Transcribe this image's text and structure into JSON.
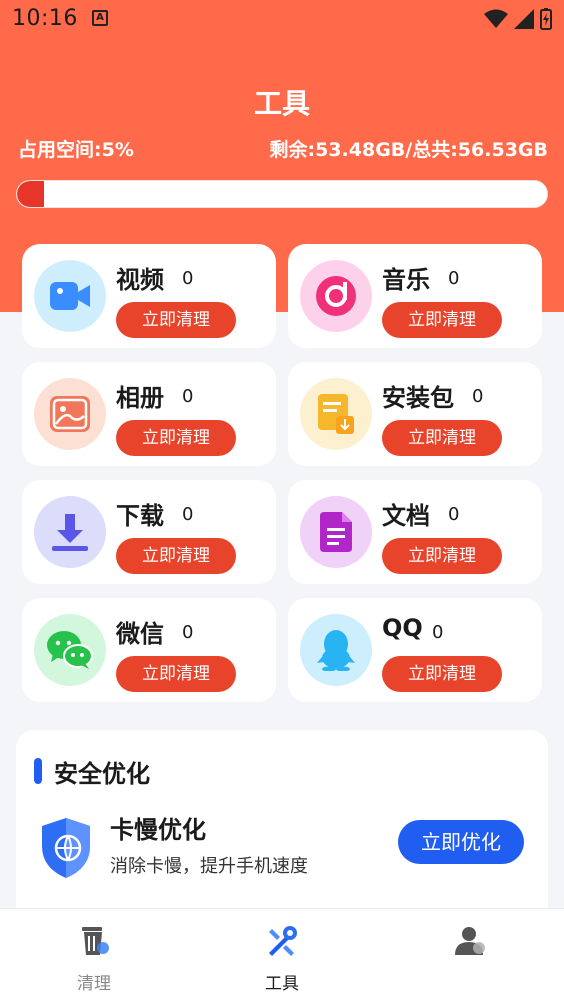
{
  "status_bar": {
    "time": "10:16",
    "notification_letter": "A"
  },
  "header": {
    "title": "工具",
    "space_used_label": "占用空间:5%",
    "space_remaining_label": "剩余:53.48GB/总共:56.53GB",
    "usage_fraction": 0.05,
    "accent_color": "#ff6a4a"
  },
  "categories": [
    {
      "title": "视频",
      "count": "0",
      "button": "立即清理",
      "icon": "video-icon"
    },
    {
      "title": "音乐",
      "count": "0",
      "button": "立即清理",
      "icon": "music-icon"
    },
    {
      "title": "相册",
      "count": "0",
      "button": "立即清理",
      "icon": "photo-album-icon"
    },
    {
      "title": "安装包",
      "count": "0",
      "button": "立即清理",
      "icon": "install-package-icon"
    },
    {
      "title": "下载",
      "count": "0",
      "button": "立即清理",
      "icon": "download-icon"
    },
    {
      "title": "文档",
      "count": "0",
      "button": "立即清理",
      "icon": "document-icon"
    },
    {
      "title": "微信",
      "count": "0",
      "button": "立即清理",
      "icon": "wechat-icon"
    },
    {
      "title": "QQ",
      "count": "0",
      "button": "立即清理",
      "icon": "qq-icon"
    }
  ],
  "safety": {
    "section_title": "安全优化",
    "item_title": "卡慢优化",
    "item_desc": "消除卡慢，提升手机速度",
    "button": "立即优化",
    "button_color": "#1f5ef0"
  },
  "tabs": [
    {
      "label": "清理",
      "icon": "trash-icon",
      "active": false
    },
    {
      "label": "工具",
      "icon": "tools-icon",
      "active": true
    },
    {
      "label": "",
      "icon": "user-profile-icon",
      "active": false
    }
  ]
}
